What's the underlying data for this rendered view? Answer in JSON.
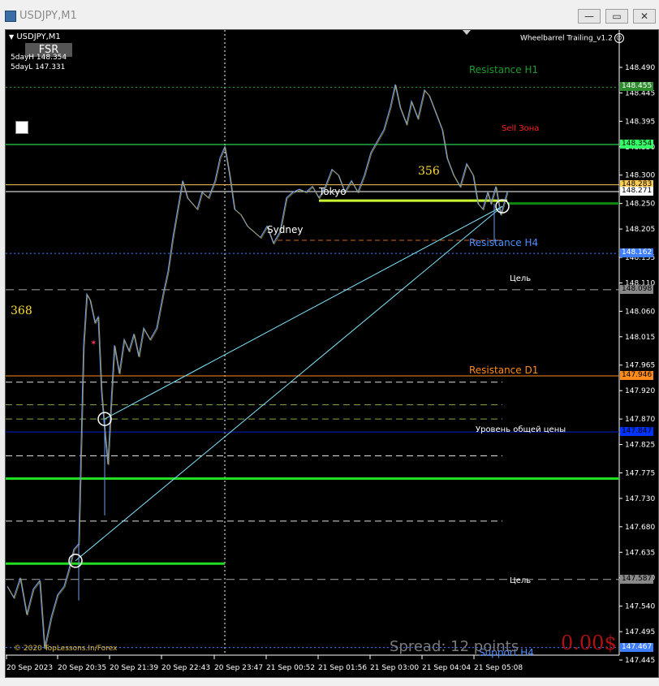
{
  "window": {
    "title": "USDJPY,M1",
    "buttons": {
      "minimize": "—",
      "restore": "▭",
      "close": "✕"
    }
  },
  "chart": {
    "symbol_label": "USDJPY,M1",
    "indicator_name": "Wheelbarrel Trailing_v1.2",
    "fsr_button": "FSR",
    "day_high": "5dayH 148.354",
    "day_low": "5dayL 147.331",
    "count_left": "368",
    "count_mid": "356",
    "copyright": "© 2020 TopLessons.In/Forex",
    "spread": "Spread: 12 points",
    "profit": "0.00$",
    "sessions": {
      "tokyo": "Tokyo",
      "sydney": "Sydney"
    }
  },
  "levels": [
    {
      "name": "Resistance H1",
      "price": "148.455",
      "color": "#1f9b2e",
      "label_color": "#1f9b2e",
      "badge_bg": "#2e8b2e",
      "badge_fg": "#ffffff"
    },
    {
      "name": "Sell Зона",
      "price": "148.354",
      "color": "#33ff66",
      "label_color": "#ff2222",
      "badge_bg": "#33ff66",
      "badge_fg": "#000000"
    },
    {
      "name": "",
      "price": "148.283",
      "color": "#ffcc55",
      "badge_bg": "#ffcc55",
      "badge_fg": "#000000"
    },
    {
      "name": "",
      "price": "148.271",
      "color": "#ffffff",
      "badge_bg": "#ffffff",
      "badge_fg": "#000000"
    },
    {
      "name": "Resistance H4",
      "price": "148.162",
      "color": "#3f7fff",
      "label_color": "#4f8fff",
      "badge_bg": "#3f7fff",
      "badge_fg": "#ffffff"
    },
    {
      "name": "Цель",
      "price": "148.098",
      "color": "#aaaaaa",
      "label_color": "#ffffff",
      "badge_bg": "#888888",
      "badge_fg": "#000000"
    },
    {
      "name": "Resistance D1",
      "price": "147.946",
      "color": "#ff8c1a",
      "label_color": "#ff8c1a",
      "badge_bg": "#ff8c1a",
      "badge_fg": "#000000"
    },
    {
      "name": "Уровень общей цены",
      "price": "147.847",
      "color": "#0022cc",
      "label_color": "#ffffff",
      "badge_bg": "#0033ff",
      "badge_fg": "#000000"
    },
    {
      "name": "Цель",
      "price": "147.587",
      "color": "#aaaaaa",
      "label_color": "#ffffff",
      "badge_bg": "#888888",
      "badge_fg": "#000000"
    },
    {
      "name": "Support H4",
      "price": "147.467",
      "color": "#3f7fff",
      "label_color": "#4f8fff",
      "badge_bg": "#3f7fff",
      "badge_fg": "#ffffff"
    }
  ],
  "price_axis": [
    "148.490",
    "148.445",
    "148.395",
    "148.350",
    "148.300",
    "148.250",
    "148.205",
    "148.155",
    "148.110",
    "148.060",
    "148.015",
    "147.965",
    "147.920",
    "147.870",
    "147.825",
    "147.775",
    "147.730",
    "147.680",
    "147.635",
    "147.590",
    "147.540",
    "147.495",
    "147.445"
  ],
  "time_axis": [
    "20 Sep 2023",
    "20 Sep 20:35",
    "20 Sep 21:39",
    "20 Sep 22:43",
    "20 Sep 23:47",
    "21 Sep 00:52",
    "21 Sep 01:56",
    "21 Sep 03:00",
    "21 Sep 04:04",
    "21 Sep 05:08"
  ],
  "colors": {
    "background": "#000000",
    "price_line": "#6f9be8",
    "trend_line": "#7fe8ff",
    "foreground": "#ffffff"
  },
  "icons": [
    "app-icon",
    "minimize-icon",
    "restore-icon",
    "close-icon",
    "smiley-icon",
    "scroll-marker-icon"
  ]
}
